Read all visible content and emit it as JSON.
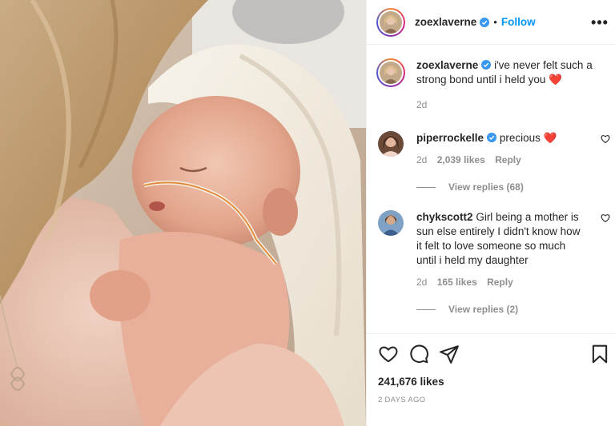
{
  "post_author": {
    "username": "zoexlaverne",
    "follow_label": "Follow",
    "separator": "•",
    "more_label": "•••"
  },
  "caption": {
    "username": "zoexlaverne",
    "text": "i've never felt such a strong bond until i held you",
    "emoji": "❤️",
    "time": "2d"
  },
  "comments": [
    {
      "username": "piperrockelle",
      "verified": true,
      "text": "precious",
      "emoji": "❤️",
      "time": "2d",
      "likes": "2,039 likes",
      "reply_label": "Reply",
      "view_replies": "View replies (68)"
    },
    {
      "username": "chykscott2",
      "verified": false,
      "text": "Girl being a mother is sun else entirely I didn't know how it felt to love someone so much until i held my daughter",
      "time": "2d",
      "likes": "165 likes",
      "reply_label": "Reply",
      "view_replies": "View replies (2)"
    }
  ],
  "actions": {
    "icons": [
      "heart-icon",
      "comment-icon",
      "share-icon",
      "bookmark-icon"
    ]
  },
  "likes_count": "241,676 likes",
  "post_timestamp": "2 DAYS AGO",
  "colors": {
    "link_blue": "#0095f6",
    "heart_red": "#ed4956",
    "muted_text": "#8e8e8e",
    "border": "#efefef"
  }
}
